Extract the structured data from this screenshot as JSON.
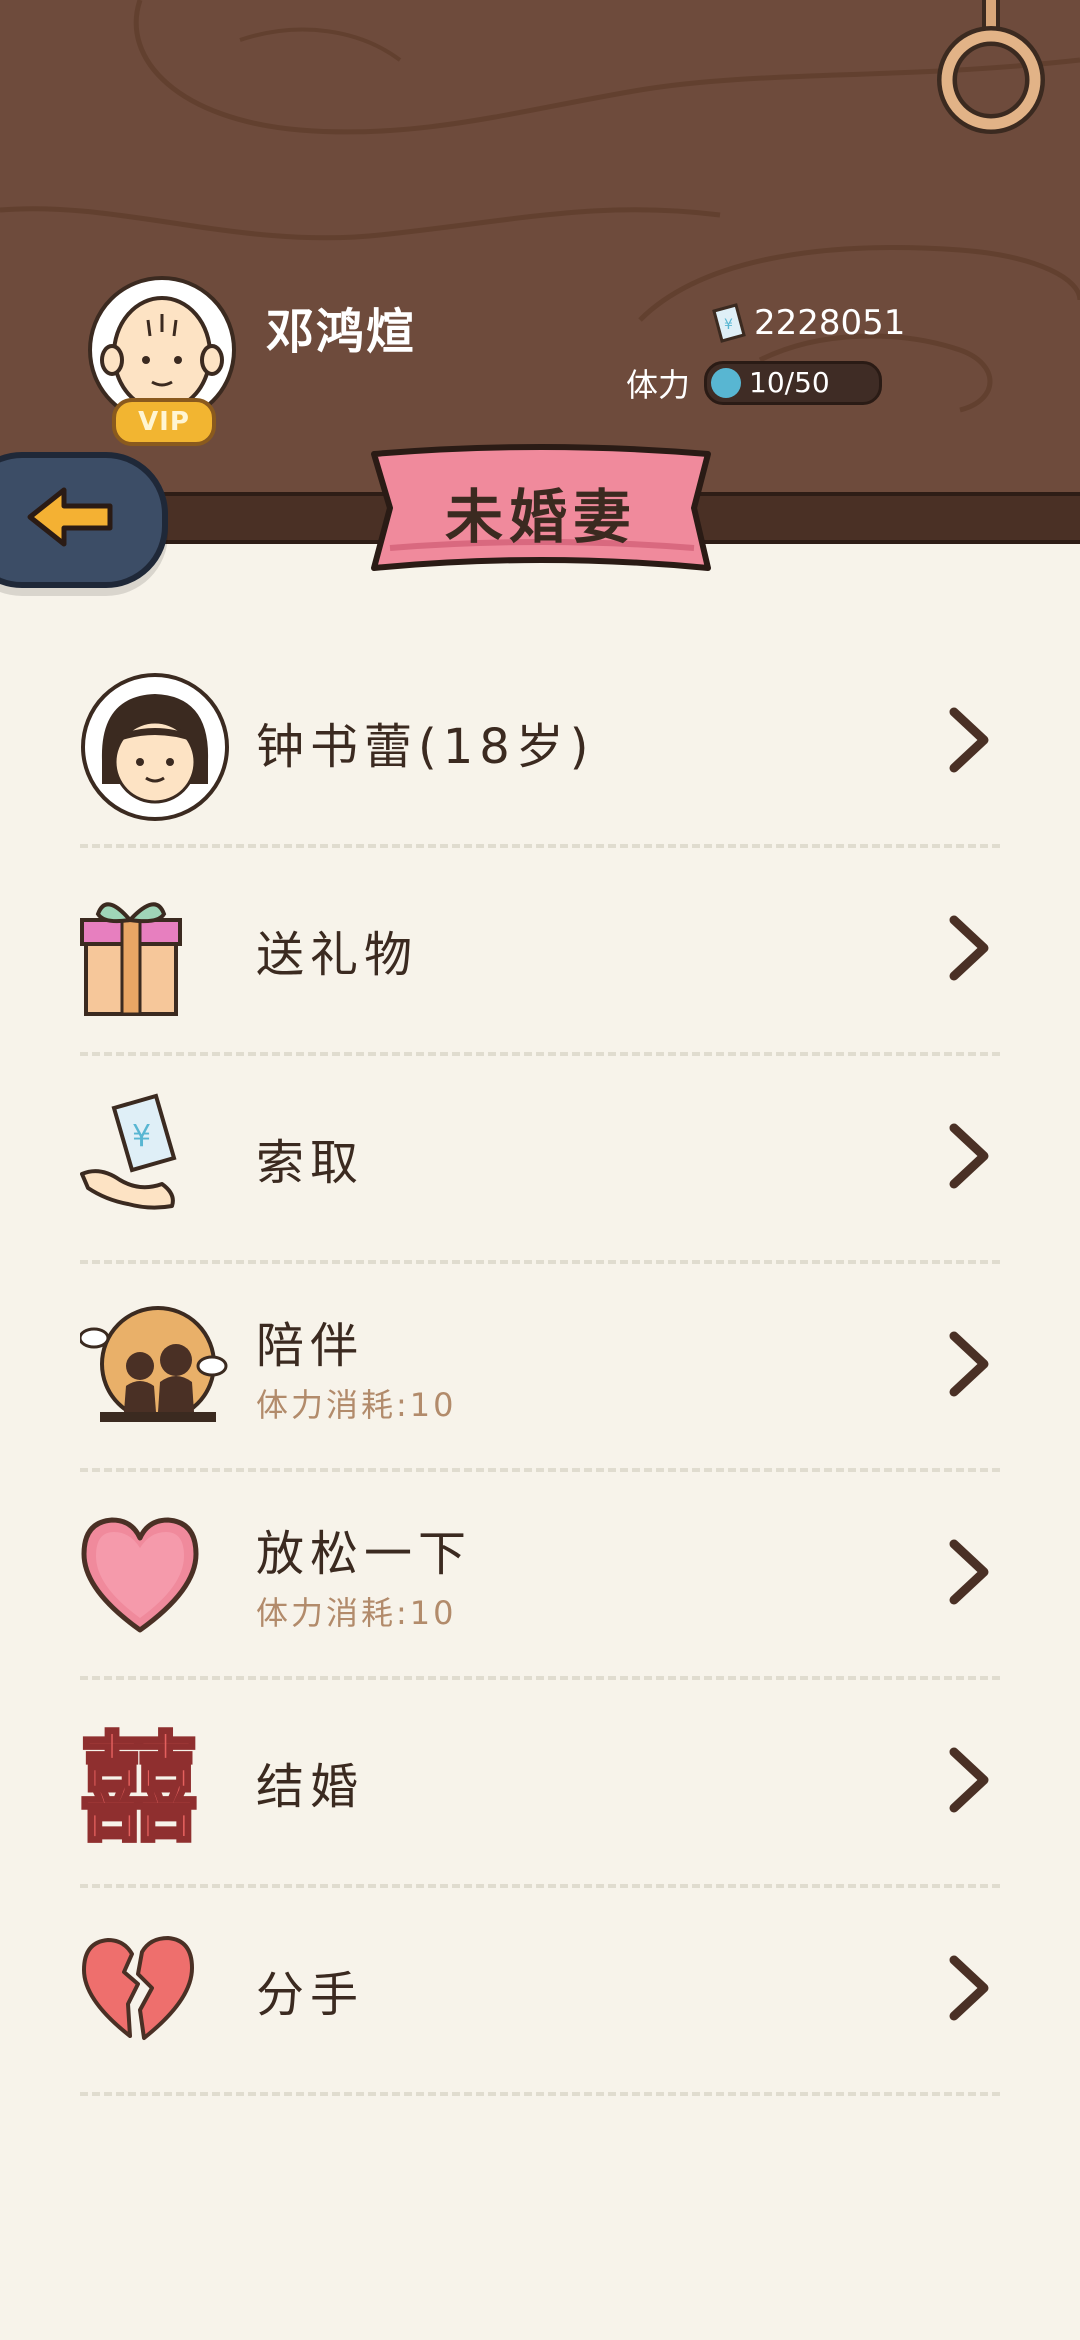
{
  "header": {
    "player_name": "邓鸿煊",
    "vip_label": "VIP",
    "money": "2228051",
    "stamina_label": "体力",
    "stamina_value": "10/50",
    "title": "未婚妻"
  },
  "icons": {
    "back": "back-arrow-icon",
    "money": "banknote-icon",
    "stamina": "stamina-dot-icon",
    "chevron": "chevron-right-icon"
  },
  "colors": {
    "wood": "#6e4b3c",
    "banner": "#f08a9c",
    "back_button": "#3c4d66",
    "arrow": "#f4b133",
    "background": "#f7f3ea",
    "stamina_dot": "#58b6d2"
  },
  "menu": [
    {
      "label": "钟书蕾(18岁)",
      "sub": "",
      "icon": "fiancee-avatar-icon"
    },
    {
      "label": "送礼物",
      "sub": "",
      "icon": "gift-icon"
    },
    {
      "label": "索取",
      "sub": "",
      "icon": "money-hand-icon"
    },
    {
      "label": "陪伴",
      "sub": "体力消耗:10",
      "icon": "companion-icon"
    },
    {
      "label": "放松一下",
      "sub": "体力消耗:10",
      "icon": "heart-icon"
    },
    {
      "label": "结婚",
      "sub": "",
      "icon": "double-happiness-icon"
    },
    {
      "label": "分手",
      "sub": "",
      "icon": "broken-heart-icon"
    }
  ]
}
